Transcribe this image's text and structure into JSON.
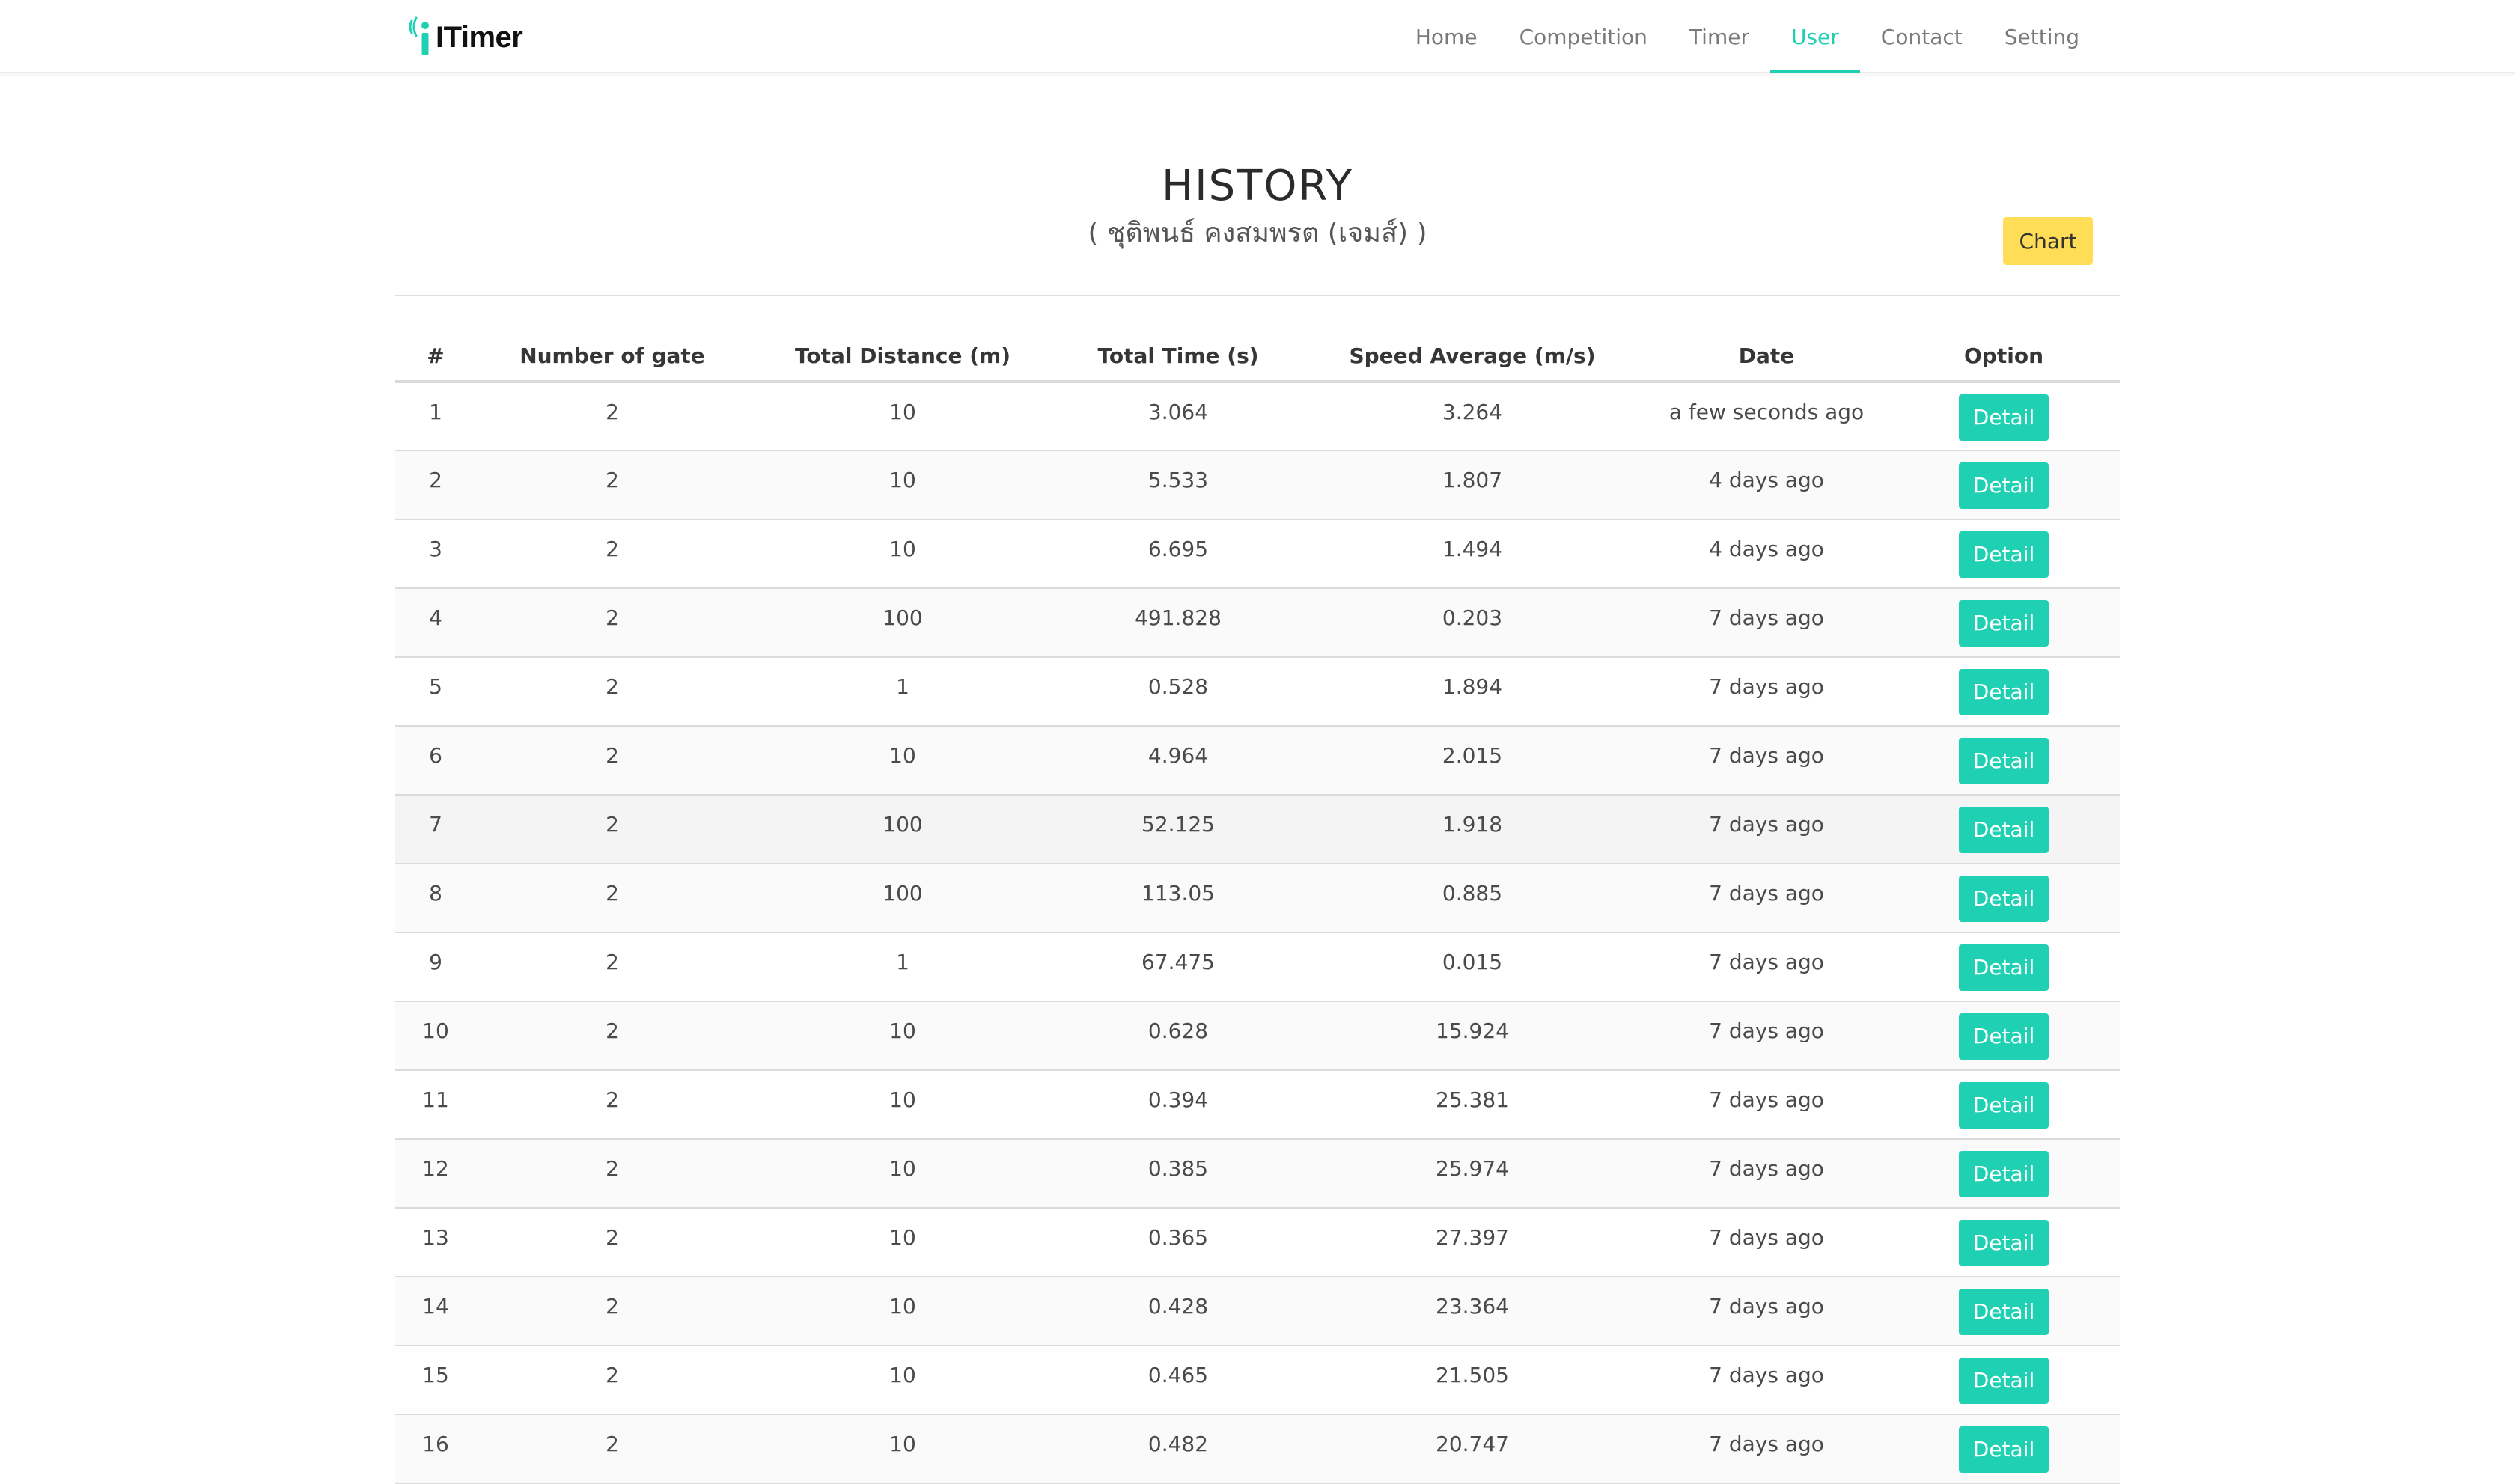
{
  "navbar": {
    "brand": "ITimer",
    "items": [
      {
        "label": "Home",
        "active": false
      },
      {
        "label": "Competition",
        "active": false
      },
      {
        "label": "Timer",
        "active": false
      },
      {
        "label": "User",
        "active": true
      },
      {
        "label": "Contact",
        "active": false
      },
      {
        "label": "Setting",
        "active": false
      }
    ]
  },
  "header": {
    "title": "HISTORY",
    "subtitle": "( ชุติพนธ์ คงสมพรต (เจมส์) )",
    "chart_button": "Chart"
  },
  "colors": {
    "accent": "#1fd1b2",
    "chart_button": "#ffdd57"
  },
  "table": {
    "columns": [
      "#",
      "Number of gate",
      "Total Distance (m)",
      "Total Time (s)",
      "Speed Average (m/s)",
      "Date",
      "Option"
    ],
    "detail_label": "Detail",
    "rows": [
      [
        "1",
        "2",
        "10",
        "3.064",
        "3.264",
        "a few seconds ago"
      ],
      [
        "2",
        "2",
        "10",
        "5.533",
        "1.807",
        "4 days ago"
      ],
      [
        "3",
        "2",
        "10",
        "6.695",
        "1.494",
        "4 days ago"
      ],
      [
        "4",
        "2",
        "100",
        "491.828",
        "0.203",
        "7 days ago"
      ],
      [
        "5",
        "2",
        "1",
        "0.528",
        "1.894",
        "7 days ago"
      ],
      [
        "6",
        "2",
        "10",
        "4.964",
        "2.015",
        "7 days ago"
      ],
      [
        "7",
        "2",
        "100",
        "52.125",
        "1.918",
        "7 days ago"
      ],
      [
        "8",
        "2",
        "100",
        "113.05",
        "0.885",
        "7 days ago"
      ],
      [
        "9",
        "2",
        "1",
        "67.475",
        "0.015",
        "7 days ago"
      ],
      [
        "10",
        "2",
        "10",
        "0.628",
        "15.924",
        "7 days ago"
      ],
      [
        "11",
        "2",
        "10",
        "0.394",
        "25.381",
        "7 days ago"
      ],
      [
        "12",
        "2",
        "10",
        "0.385",
        "25.974",
        "7 days ago"
      ],
      [
        "13",
        "2",
        "10",
        "0.365",
        "27.397",
        "7 days ago"
      ],
      [
        "14",
        "2",
        "10",
        "0.428",
        "23.364",
        "7 days ago"
      ],
      [
        "15",
        "2",
        "10",
        "0.465",
        "21.505",
        "7 days ago"
      ],
      [
        "16",
        "2",
        "10",
        "0.482",
        "20.747",
        "7 days ago"
      ]
    ]
  }
}
